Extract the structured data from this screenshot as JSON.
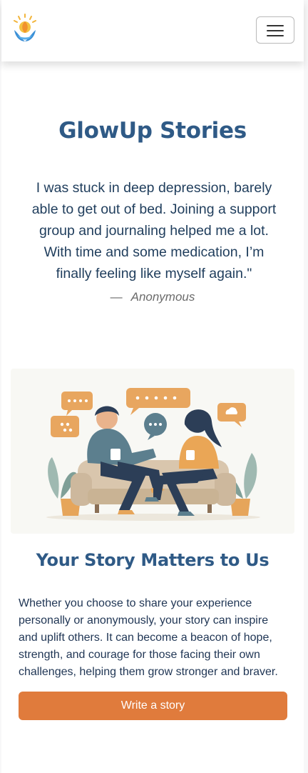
{
  "navbar": {
    "logo_icon": "lotus-sun-logo-icon",
    "menu_icon": "hamburger-menu-icon"
  },
  "hero": {
    "title": "GlowUp Stories",
    "quote": "I was stuck in deep depression, barely able to get out of bed. Joining a support group and journaling helped me a lot. With time and some medication, I’m finally feeling like myself again.\"",
    "attribution_dash": "—",
    "attribution": "Anonymous"
  },
  "story": {
    "illustration": "two-people-talking-on-couch-illustration",
    "heading": "Your Story Matters to Us",
    "body": "Whether you choose to share your experience personally or anonymously, your story can inspire and uplift others. It can become a beacon of hope, strength, and courage for those facing their own challenges, helping them grow stronger and braver.",
    "button_label": "Write a story"
  },
  "colors": {
    "primary": "#2f5a86",
    "accent": "#e07b3c",
    "text": "#1f3d5c"
  }
}
